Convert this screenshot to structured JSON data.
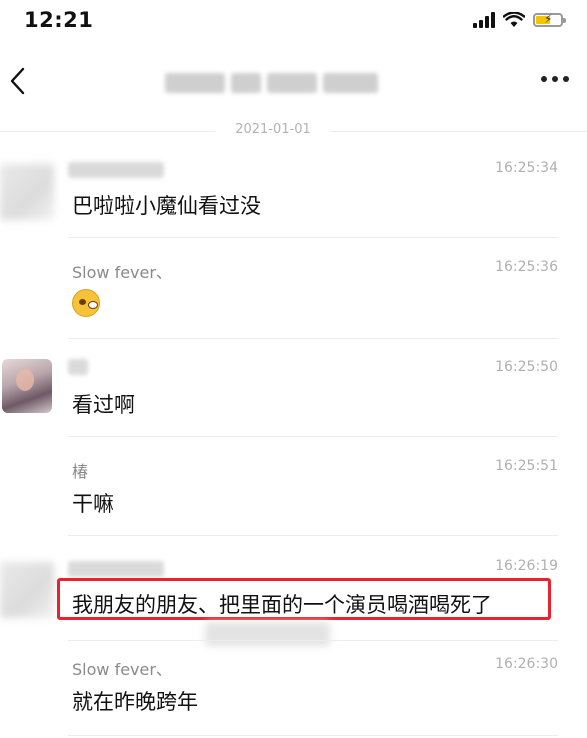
{
  "status_bar": {
    "time": "12:21"
  },
  "header": {
    "title_hidden": true
  },
  "date_separator": "2021-01-01",
  "messages": [
    {
      "sender": "",
      "time": "16:25:34",
      "text": "巴啦啦小魔仙看过没"
    },
    {
      "sender": "Slow fever、",
      "time": "16:25:36",
      "emoji": "laughing-emoji"
    },
    {
      "sender": "",
      "time": "16:25:50",
      "text": "看过啊"
    },
    {
      "sender": "椿",
      "time": "16:25:51",
      "text": "干嘛"
    },
    {
      "sender": "",
      "time": "16:26:19",
      "text": "我朋友的朋友、把里面的一个演员喝酒喝死了"
    },
    {
      "sender": "Slow fever、",
      "time": "16:26:30",
      "text": "就在昨晚跨年"
    }
  ],
  "colors": {
    "highlight": "#e8232d",
    "battery": "#f5c500",
    "timestamp": "#b0b0b0"
  }
}
